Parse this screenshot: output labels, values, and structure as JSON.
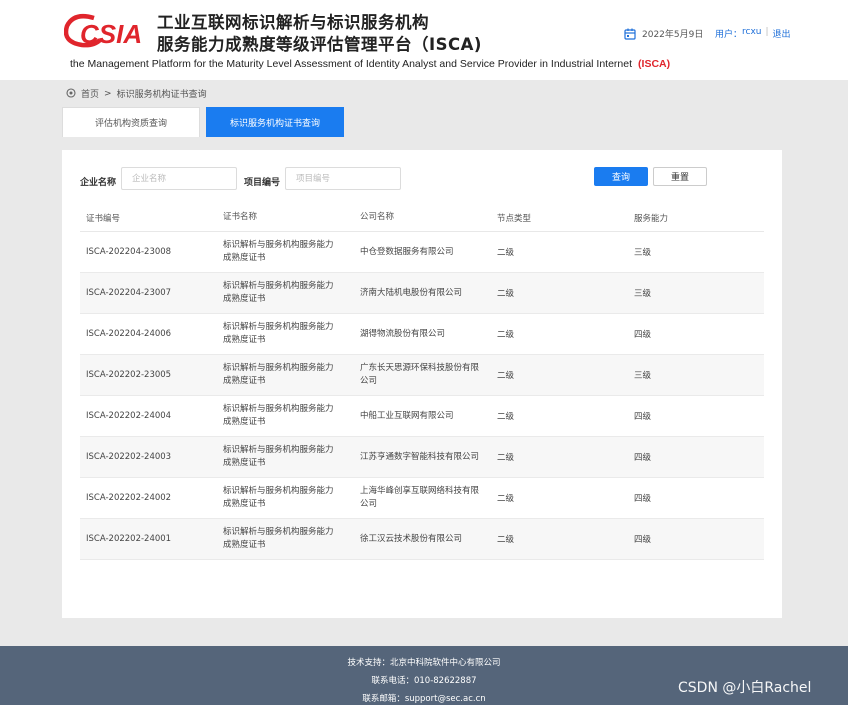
{
  "header": {
    "logo_text": "CSIA",
    "title_line1": "工业互联网标识解析与标识服务机构",
    "title_line2": "服务能力成熟度等级评估管理平台（ISCA)",
    "title_en": "the Management Platform for the Maturity Level Assessment of Identity Analyst and Service Provider in Industrial Internet",
    "title_en_tag": "(ISCA)",
    "date": "2022年5月9日",
    "user_label": "用户：",
    "user_name": "rcxu",
    "separator": "|",
    "logout": "退出"
  },
  "breadcrumb": {
    "home": "首页",
    "arrow": ">",
    "current": "标识服务机构证书查询"
  },
  "tabs": [
    {
      "label": "评估机构资质查询",
      "active": false
    },
    {
      "label": "标识服务机构证书查询",
      "active": true
    }
  ],
  "filters": {
    "company_label": "企业名称",
    "company_placeholder": "企业名称",
    "project_label": "项目编号",
    "project_placeholder": "项目编号",
    "query_button": "查询",
    "reset_button": "重置"
  },
  "table": {
    "headers": [
      "证书编号",
      "证书名称",
      "公司名称",
      "节点类型",
      "服务能力"
    ],
    "rows": [
      [
        "ISCA-202204-23008",
        "标识解析与服务机构服务能力成熟度证书",
        "中仓登数据服务有限公司",
        "二级",
        "三级"
      ],
      [
        "ISCA-202204-23007",
        "标识解析与服务机构服务能力成熟度证书",
        "济南大陆机电股份有限公司",
        "二级",
        "三级"
      ],
      [
        "ISCA-202204-24006",
        "标识解析与服务机构服务能力成熟度证书",
        "湖得物流股份有限公司",
        "二级",
        "四级"
      ],
      [
        "ISCA-202202-23005",
        "标识解析与服务机构服务能力成熟度证书",
        "广东长天思源环保科技股份有限公司",
        "二级",
        "三级"
      ],
      [
        "ISCA-202202-24004",
        "标识解析与服务机构服务能力成熟度证书",
        "中船工业互联网有限公司",
        "二级",
        "四级"
      ],
      [
        "ISCA-202202-24003",
        "标识解析与服务机构服务能力成熟度证书",
        "江苏亨通数字智能科技有限公司",
        "二级",
        "四级"
      ],
      [
        "ISCA-202202-24002",
        "标识解析与服务机构服务能力成熟度证书",
        "上海华峰创享互联网络科技有限公司",
        "二级",
        "四级"
      ],
      [
        "ISCA-202202-24001",
        "标识解析与服务机构服务能力成熟度证书",
        "徐工汉云技术股份有限公司",
        "二级",
        "四级"
      ]
    ]
  },
  "footer": {
    "support": "技术支持：北京中科院软件中心有限公司",
    "phone": "联系电话：010-82622887",
    "email": "联系邮箱：support@sec.ac.cn"
  },
  "watermark": "CSDN @小白Rachel",
  "colors": {
    "primary": "#1a7cf0",
    "logo_red": "#e0252c",
    "footer_bg": "#55657a",
    "link": "#1e6fd9"
  },
  "icons": {
    "date": "calendar-icon",
    "breadcrumb": "location-pin-icon"
  }
}
